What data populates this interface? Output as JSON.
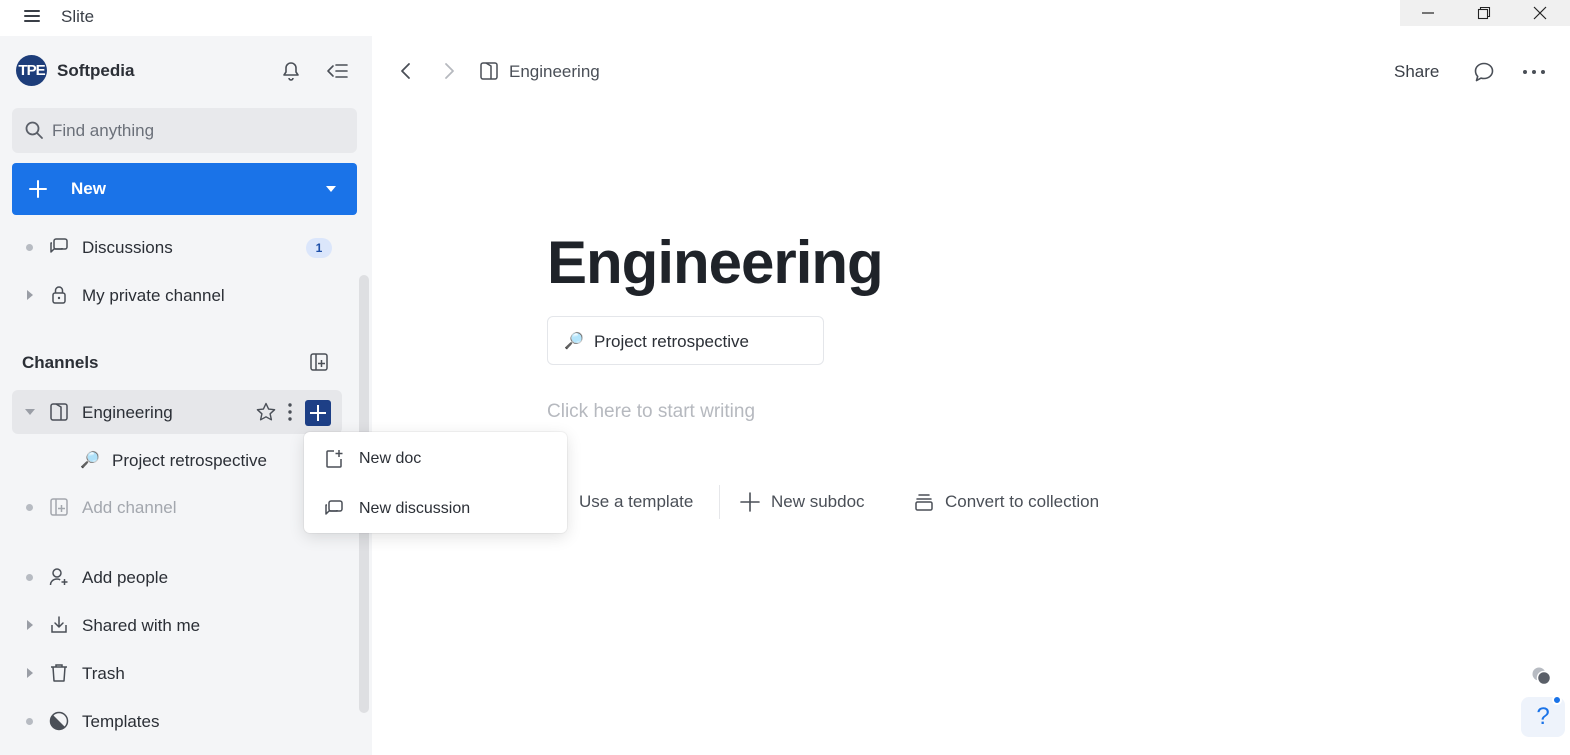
{
  "app": {
    "title": "Slite"
  },
  "workspace": {
    "logo_text": "TPE",
    "name": "Softpedia"
  },
  "search": {
    "placeholder": "Find anything"
  },
  "new_button": {
    "label": "New"
  },
  "sidebar": {
    "discussions": {
      "label": "Discussions",
      "count": "1"
    },
    "private_channel": {
      "label": "My private channel"
    },
    "channels_header": "Channels",
    "channel": {
      "label": "Engineering"
    },
    "channel_doc": {
      "emoji": "🔎",
      "label": "Project retrospective"
    },
    "add_channel": {
      "label": "Add channel"
    },
    "add_people": {
      "label": "Add people"
    },
    "shared": {
      "label": "Shared with me"
    },
    "trash": {
      "label": "Trash"
    },
    "templates": {
      "label": "Templates"
    }
  },
  "menu": {
    "new_doc": "New doc",
    "new_discussion": "New discussion"
  },
  "topbar": {
    "breadcrumb": "Engineering",
    "share": "Share"
  },
  "document": {
    "title": "Engineering",
    "subdoc": {
      "emoji": "🔎",
      "label": "Project retrospective"
    },
    "placeholder": "Click here to start writing",
    "actions": {
      "template": "Use a template",
      "subdoc": "New subdoc",
      "collection": "Convert to collection"
    }
  },
  "help": {
    "label": "?"
  },
  "colors": {
    "accent": "#1a73e8",
    "sidebar_bg": "#f4f5f7",
    "add_btn": "#1d3f86"
  }
}
